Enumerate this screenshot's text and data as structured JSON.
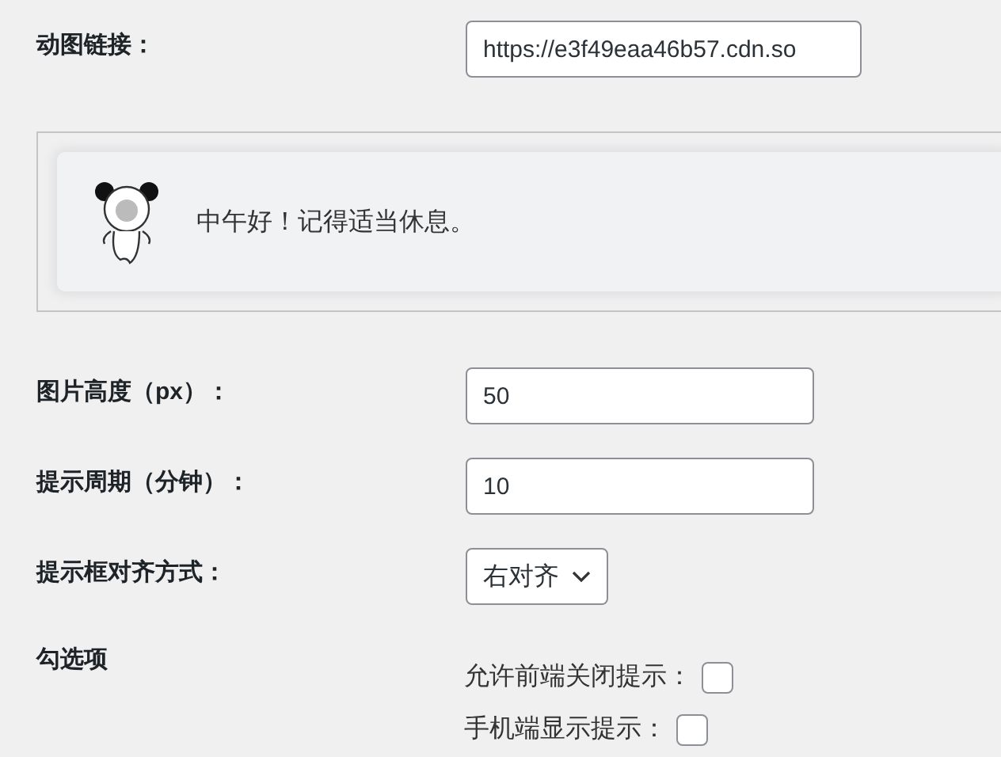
{
  "gif_link": {
    "label": "动图链接：",
    "value": "https://e3f49eaa46b57.cdn.so"
  },
  "preview": {
    "message": "中午好！记得适当休息。"
  },
  "image_height": {
    "label": "图片高度（px）：",
    "value": "50"
  },
  "period": {
    "label": "提示周期（分钟）：",
    "value": "10"
  },
  "alignment": {
    "label": "提示框对齐方式：",
    "value": "右对齐"
  },
  "options": {
    "label": "勾选项",
    "items": [
      {
        "label": "允许前端关闭提示：",
        "checked": false
      },
      {
        "label": "手机端显示提示：",
        "checked": false
      }
    ]
  }
}
